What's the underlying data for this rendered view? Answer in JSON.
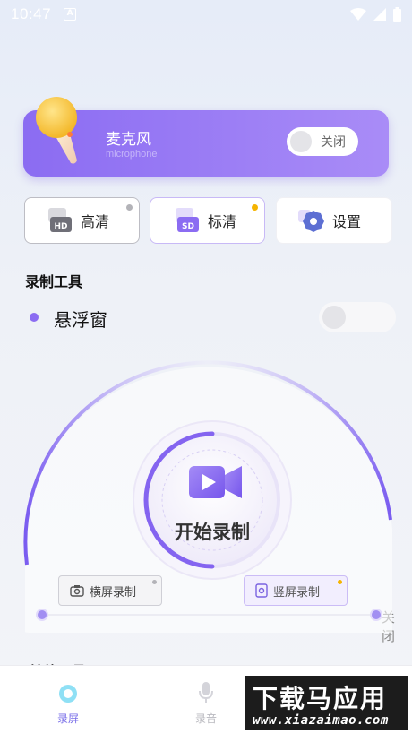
{
  "status_bar": {
    "time": "10:47",
    "notification_glyph": "A"
  },
  "mic_card": {
    "title": "麦克风",
    "subtitle": "microphone",
    "toggle_label": "关闭"
  },
  "quality": [
    {
      "label": "高清",
      "icon_text": "HD",
      "dot_color": "#b3b3b8"
    },
    {
      "label": "标清",
      "icon_text": "SD",
      "dot_color": "#f5b400"
    },
    {
      "label": "设置"
    }
  ],
  "tools": {
    "title": "录制工具",
    "float_window_label": "悬浮窗",
    "float_toggle_label": "关闭"
  },
  "recorder": {
    "start_label": "开始录制",
    "landscape_label": "横屏录制",
    "portrait_label": "竖屏录制"
  },
  "hidden_row_label": "其他工具",
  "bottom_nav": {
    "record_screen": "录屏",
    "record_audio": "录音"
  },
  "watermark": {
    "big": "下载马应用",
    "small": "www.xiazaimao.com"
  },
  "colors": {
    "accent": "#8b6cf2",
    "accent_light": "#c8b9f6",
    "badge_yellow": "#f5b400"
  }
}
